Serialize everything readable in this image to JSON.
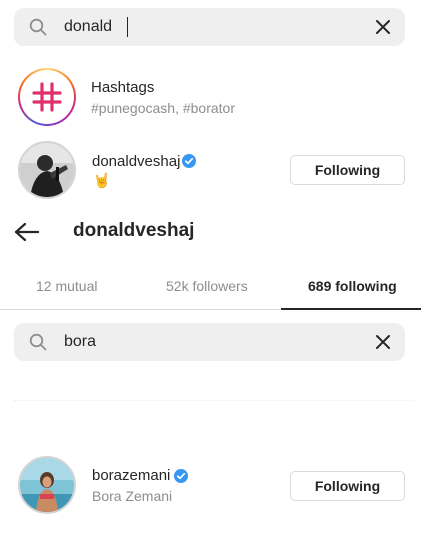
{
  "top_search": {
    "query": "donald"
  },
  "hashtags_row": {
    "title": "Hashtags",
    "subtitle": "#punegocash, #borator"
  },
  "donald_row": {
    "username": "donaldveshaj",
    "emoji": "🤘",
    "button_label": "Following"
  },
  "profile_header": {
    "title": "donaldveshaj"
  },
  "tabs": [
    {
      "label": "12 mutual",
      "active": false
    },
    {
      "label": "52k followers",
      "active": false
    },
    {
      "label": "689 following",
      "active": true
    }
  ],
  "list_search": {
    "query": "bora"
  },
  "bora_row": {
    "username": "borazemani",
    "full_name": "Bora Zemani",
    "button_label": "Following"
  },
  "colors": {
    "verified": "#3897f0",
    "hashtag": "#e1306c",
    "text_secondary": "#8e8e8e",
    "search_bg": "#efefef"
  },
  "icons": [
    "search-icon",
    "close-icon",
    "hashtag-icon",
    "verified-badge-icon",
    "back-arrow-icon"
  ]
}
